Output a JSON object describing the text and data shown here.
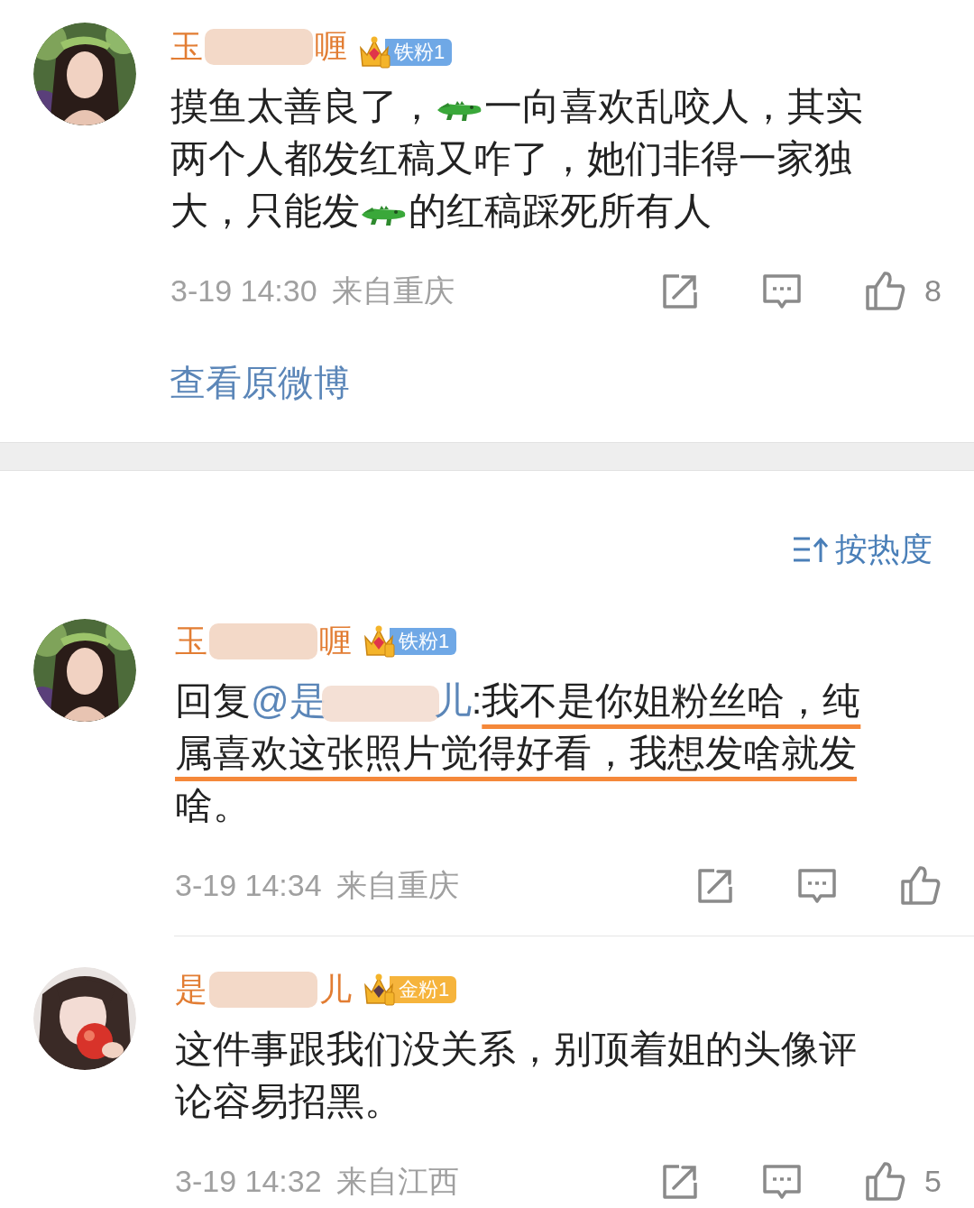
{
  "original_comment": {
    "avatar": {
      "kind": "picture"
    },
    "author": {
      "name_start": "玉",
      "name_end": "喱"
    },
    "badge": {
      "kind": "iron",
      "label": "铁粉1"
    },
    "lines": [
      [
        {
          "kind": "text",
          "text": "摸鱼太善良了，"
        },
        {
          "kind": "emoji"
        },
        {
          "kind": "text",
          "text": "一向喜欢乱咬人，其实"
        }
      ],
      [
        {
          "kind": "text",
          "text": "两个人都发红稿又咋了，她们非得一家独"
        }
      ],
      [
        {
          "kind": "text",
          "text": "大，只能发"
        },
        {
          "kind": "emoji"
        },
        {
          "kind": "text",
          "text": "的红稿踩死所有人"
        }
      ]
    ],
    "time": "3-19 14:30",
    "location": "来自重庆",
    "likes": "8"
  },
  "view_original_link": "查看原微博",
  "sort_button": "按热度",
  "comments": [
    {
      "avatar": {
        "kind": "picture"
      },
      "author": {
        "name_start": "玉",
        "name_end": "喱"
      },
      "badge": {
        "kind": "iron",
        "label": "铁粉1"
      },
      "lines": [
        [
          {
            "kind": "text",
            "text": "回复"
          },
          {
            "kind": "mention",
            "text_start": "@是",
            "text_end": "儿"
          },
          {
            "kind": "text",
            "text": ":"
          },
          {
            "kind": "text",
            "text": "我不是你姐粉丝哈，纯",
            "underlined": true
          }
        ],
        [
          {
            "kind": "text",
            "text": "属喜欢这张照片觉得好看，我想发啥就发",
            "underlined": true
          }
        ],
        [
          {
            "kind": "text",
            "text": "啥。"
          }
        ]
      ],
      "time": "3-19 14:34",
      "location": "来自重庆"
    },
    {
      "avatar": {
        "kind": "picture"
      },
      "author": {
        "name_start": "是",
        "name_end": "儿"
      },
      "badge": {
        "kind": "gold",
        "label": "金粉1"
      },
      "lines": [
        [
          {
            "kind": "text",
            "text": "这件事跟我们没关系，别顶着姐的头像评"
          }
        ],
        [
          {
            "kind": "text",
            "text": "论容易招黑。"
          }
        ]
      ],
      "time": "3-19 14:32",
      "location": "来自江西",
      "likes": "5"
    }
  ]
}
